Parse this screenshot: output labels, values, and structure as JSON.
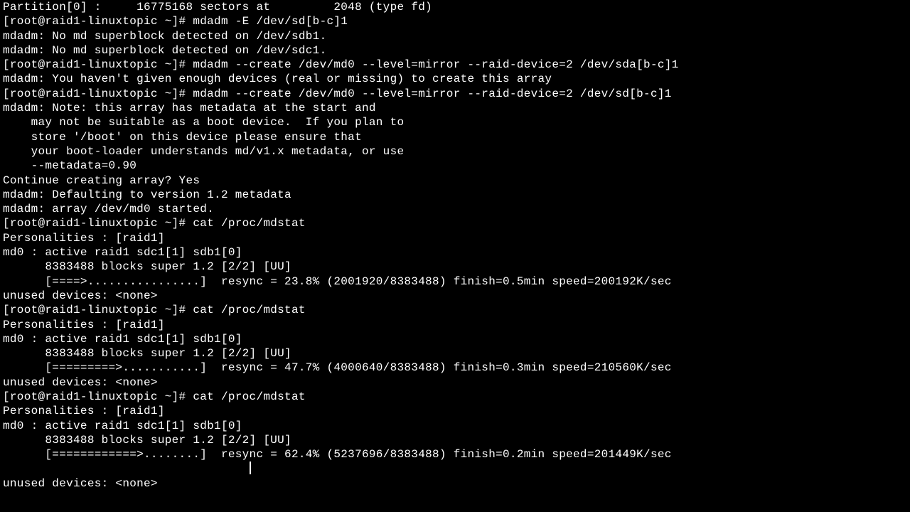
{
  "terminal": {
    "prompt": "[root@raid1-linuxtopic ~]# ",
    "lines": [
      "Partition[0] :     16775168 sectors at         2048 (type fd)",
      "[root@raid1-linuxtopic ~]# mdadm -E /dev/sd[b-c]1",
      "mdadm: No md superblock detected on /dev/sdb1.",
      "mdadm: No md superblock detected on /dev/sdc1.",
      "[root@raid1-linuxtopic ~]# mdadm --create /dev/md0 --level=mirror --raid-device=2 /dev/sda[b-c]1",
      "mdadm: You haven't given enough devices (real or missing) to create this array",
      "[root@raid1-linuxtopic ~]# mdadm --create /dev/md0 --level=mirror --raid-device=2 /dev/sd[b-c]1",
      "mdadm: Note: this array has metadata at the start and",
      "    may not be suitable as a boot device.  If you plan to",
      "    store '/boot' on this device please ensure that",
      "    your boot-loader understands md/v1.x metadata, or use",
      "    --metadata=0.90",
      "Continue creating array? Yes",
      "mdadm: Defaulting to version 1.2 metadata",
      "mdadm: array /dev/md0 started.",
      "[root@raid1-linuxtopic ~]# cat /proc/mdstat",
      "Personalities : [raid1]",
      "md0 : active raid1 sdc1[1] sdb1[0]",
      "      8383488 blocks super 1.2 [2/2] [UU]",
      "      [====>................]  resync = 23.8% (2001920/8383488) finish=0.5min speed=200192K/sec",
      "",
      "unused devices: <none>",
      "[root@raid1-linuxtopic ~]# cat /proc/mdstat",
      "Personalities : [raid1]",
      "md0 : active raid1 sdc1[1] sdb1[0]",
      "      8383488 blocks super 1.2 [2/2] [UU]",
      "      [=========>...........]  resync = 47.7% (4000640/8383488) finish=0.3min speed=210560K/sec",
      "",
      "unused devices: <none>",
      "[root@raid1-linuxtopic ~]# cat /proc/mdstat",
      "Personalities : [raid1]",
      "md0 : active raid1 sdc1[1] sdb1[0]",
      "      8383488 blocks super 1.2 [2/2] [UU]",
      "      [============>........]  resync = 62.4% (5237696/8383488) finish=0.2min speed=201449K/sec",
      "",
      "unused devices: <none>"
    ],
    "mdstat": {
      "personalities": "[raid1]",
      "device": "md0",
      "state": "active raid1",
      "members": "sdc1[1] sdb1[0]",
      "blocks": 8383488,
      "super": "1.2",
      "raid_status": "[2/2] [UU]",
      "snapshots": [
        {
          "bar": "[====>................]",
          "percent": 23.8,
          "done": 2001920,
          "total": 8383488,
          "finish_min": 0.5,
          "speed_k_per_sec": 200192
        },
        {
          "bar": "[=========>...........]",
          "percent": 47.7,
          "done": 4000640,
          "total": 8383488,
          "finish_min": 0.3,
          "speed_k_per_sec": 210560
        },
        {
          "bar": "[============>........]",
          "percent": 62.4,
          "done": 5237696,
          "total": 8383488,
          "finish_min": 0.2,
          "speed_k_per_sec": 201449
        }
      ]
    }
  }
}
